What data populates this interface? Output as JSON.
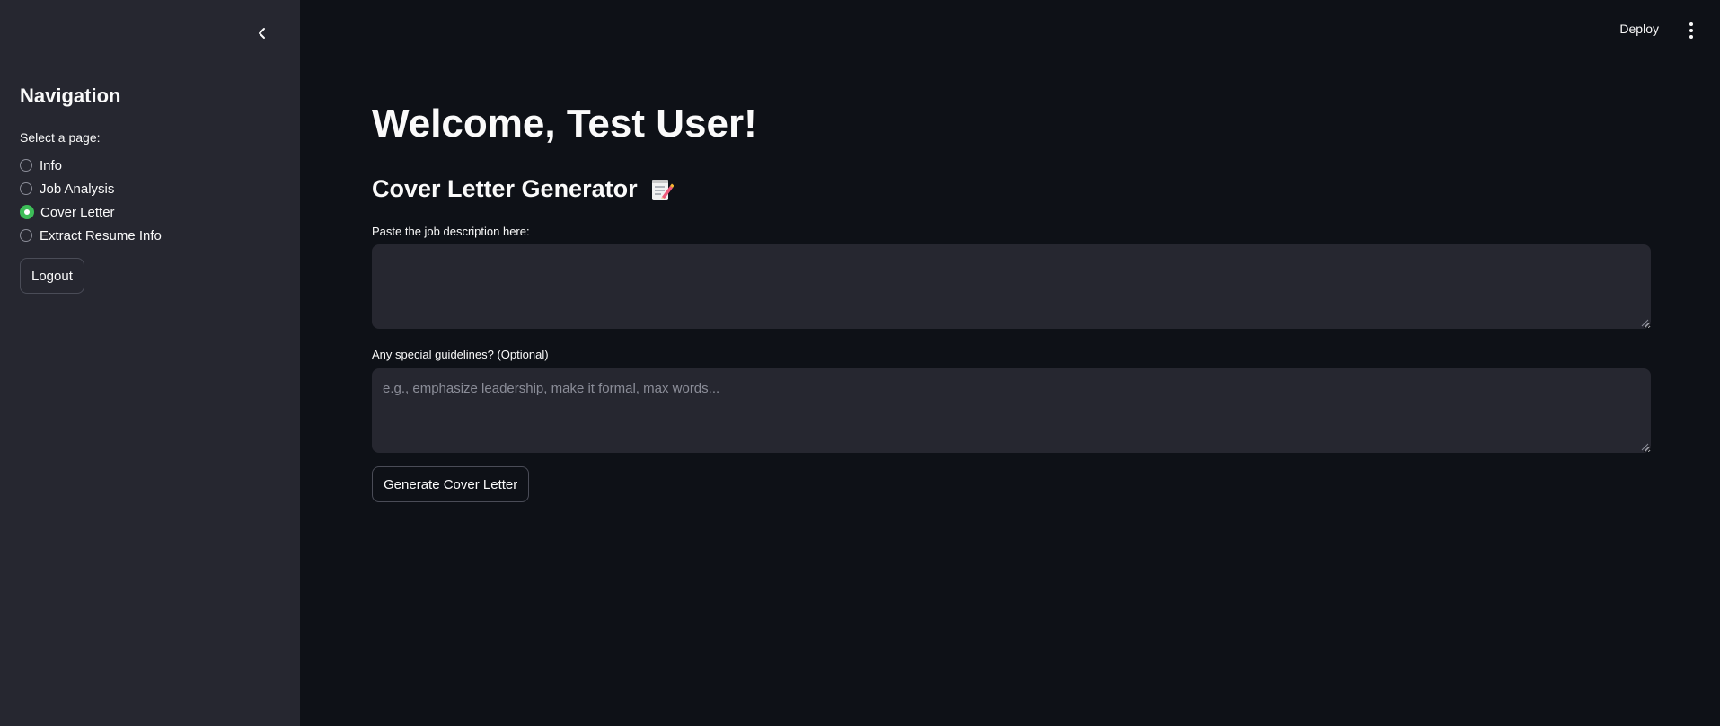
{
  "sidebar": {
    "title": "Navigation",
    "radio_label": "Select a page:",
    "options": [
      {
        "label": "Info",
        "selected": false
      },
      {
        "label": "Job Analysis",
        "selected": false
      },
      {
        "label": "Cover Letter",
        "selected": true
      },
      {
        "label": "Extract Resume Info",
        "selected": false
      }
    ],
    "logout_label": "Logout",
    "collapse_icon": "chevron-left-icon"
  },
  "header": {
    "deploy_label": "Deploy",
    "menu_icon": "more-vertical-icon"
  },
  "main": {
    "welcome": "Welcome, Test User!",
    "subheader": "Cover Letter Generator",
    "subheader_icon": "memo-icon",
    "job_description": {
      "label": "Paste the job description here:",
      "value": "",
      "placeholder": ""
    },
    "guidelines": {
      "label": "Any special guidelines? (Optional)",
      "value": "",
      "placeholder": "e.g., emphasize leadership, make it formal, max words..."
    },
    "generate_label": "Generate Cover Letter"
  },
  "colors": {
    "background": "#0e1117",
    "sidebar": "#262730",
    "accent_selected": "#3dbd58",
    "text": "#fafafa"
  }
}
